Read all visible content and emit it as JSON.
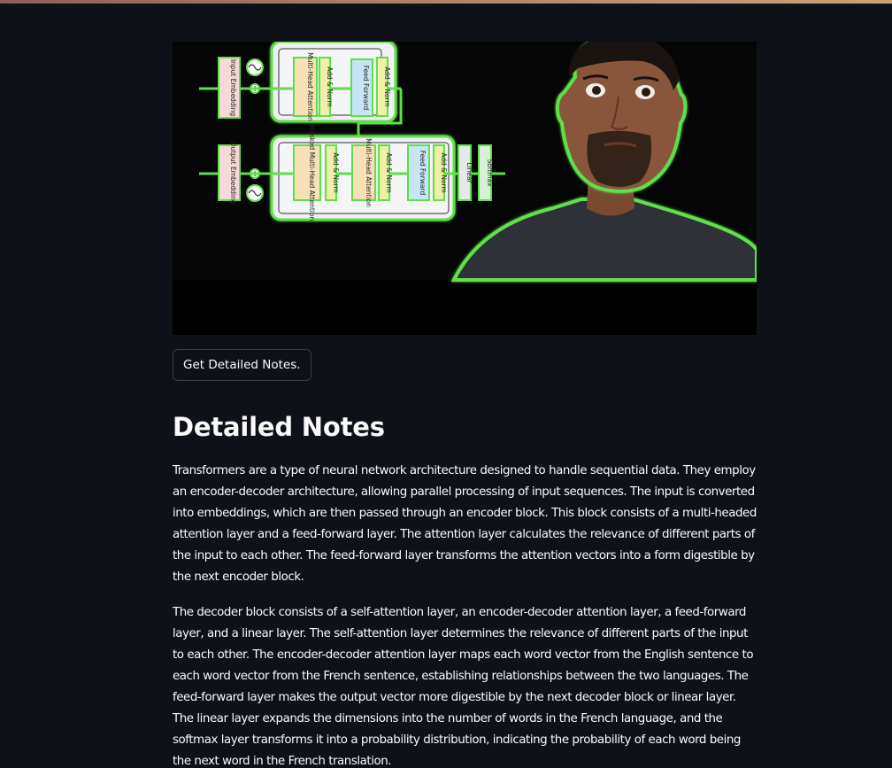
{
  "thumbnail": {
    "diagram_labels": {
      "input_embedding": "Input Embedding",
      "output_embedding": "Output Embedding",
      "multi_head_attention": "Multi-Head Attention",
      "masked_multi_head_attention": "Masked Multi-Head Attention",
      "add_norm": "Add & Norm",
      "feed_forward": "Feed Forward",
      "linear": "Linear",
      "softmax": "Softmax"
    }
  },
  "button": {
    "label": "Get Detailed Notes."
  },
  "notes": {
    "title": "Detailed Notes",
    "paragraph_1": "Transformers are a type of neural network architecture designed to handle sequential data. They employ an encoder-decoder architecture, allowing parallel processing of input sequences. The input is converted into embeddings, which are then passed through an encoder block. This block consists of a multi-headed attention layer and a feed-forward layer. The attention layer calculates the relevance of different parts of the input to each other. The feed-forward layer transforms the attention vectors into a form digestible by the next encoder block.",
    "paragraph_2": "The decoder block consists of a self-attention layer, an encoder-decoder attention layer, a feed-forward layer, and a linear layer. The self-attention layer determines the relevance of different parts of the input to each other. The encoder-decoder attention layer maps each word vector from the English sentence to each word vector from the French sentence, establishing relationships between the two languages. The feed-forward layer makes the output vector more digestible by the next decoder block or linear layer. The linear layer expands the dimensions into the number of words in the French language, and the softmax layer transforms it into a probability distribution, indicating the probability of each word being the next word in the French translation."
  },
  "colors": {
    "page_background": "#0e1117",
    "text": "#fafafa",
    "button_border": "#3a3d46",
    "accent_green": "#5ee04a",
    "attention_block": "#f7e0b5",
    "feed_forward_block": "#c6e6f5",
    "add_norm_block": "#eef0a8",
    "embedding_block": "#f6d8d8"
  }
}
